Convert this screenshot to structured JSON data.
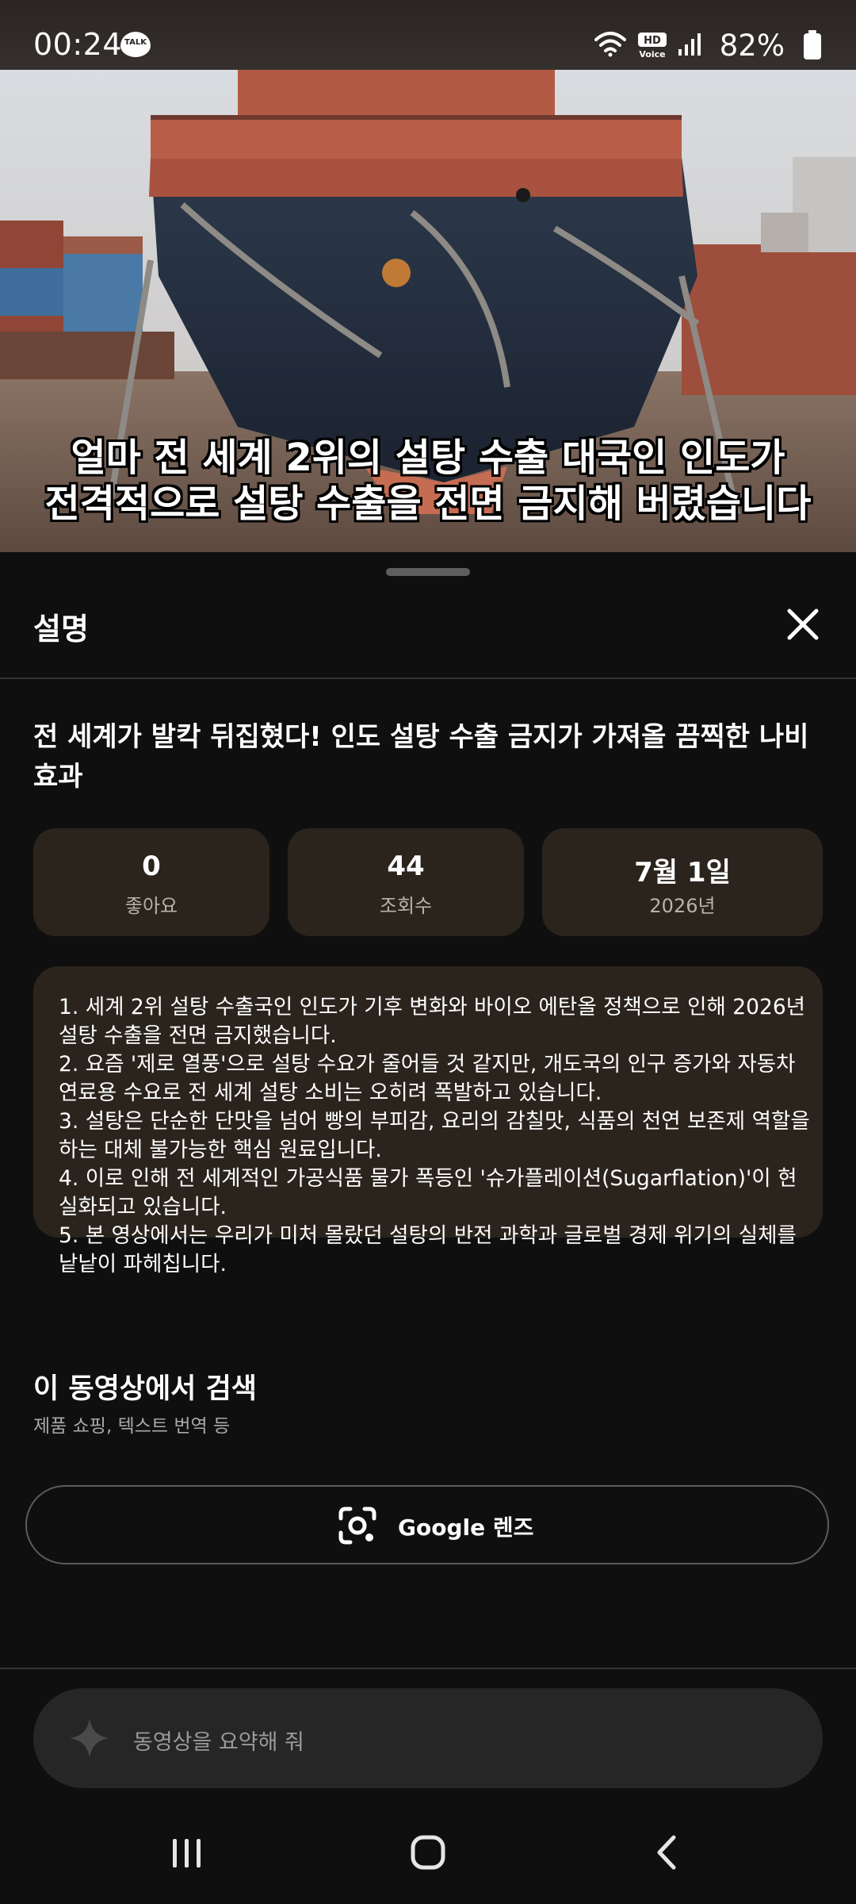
{
  "status_bar": {
    "time": "00:24",
    "talk_badge": "TALK",
    "hd_badge": "HD",
    "voice_badge": "Voice",
    "battery": "82%",
    "icons": [
      "kakaotalk-icon",
      "wifi-icon",
      "hd-voice-icon",
      "signal-icon",
      "battery-icon"
    ]
  },
  "video": {
    "subtitle_line1": "얼마 전 세계 2위의 설탕 수출 대국인 인도가",
    "subtitle_line2": "전격적으로 설탕 수출을 전면 금지해 버렸습니다"
  },
  "sheet": {
    "title": "설명",
    "close_icon": "close-icon"
  },
  "video_info": {
    "title": "전 세계가 발칵 뒤집혔다! 인도 설탕 수출 금지가 가져올 끔찍한 나비효과",
    "stats": [
      {
        "value": "0",
        "label": "좋아요"
      },
      {
        "value": "44",
        "label": "조회수"
      },
      {
        "value": "7월 1일",
        "label": "2026년"
      }
    ]
  },
  "description": {
    "lines": [
      "1. 세계 2위 설탕 수출국인 인도가 기후 변화와 바이오 에탄올 정책으로 인해 2026년 설탕 수출을 전면 금지했습니다.",
      "2. 요즘 '제로 열풍'으로 설탕 수요가 줄어들 것 같지만, 개도국의 인구 증가와 자동차 연료용 수요로 전 세계 설탕 소비는 오히려 폭발하고 있습니다.",
      "3. 설탕은 단순한 단맛을 넘어 빵의 부피감, 요리의 감칠맛, 식품의 천연 보존제 역할을 하는 대체 불가능한 핵심 원료입니다.",
      "4. 이로 인해 전 세계적인 가공식품 물가 폭등인 '슈가플레이션(Sugarflation)'이 현실화되고 있습니다.",
      "5. 본 영상에서는 우리가 미처 몰랐던 설탕의 반전 과학과 글로벌 경제 위기의 실체를 낱낱이 파헤칩니다."
    ]
  },
  "search_in_video": {
    "title": "이 동영상에서 검색",
    "subtitle": "제품 쇼핑, 텍스트 번역 등",
    "lens_button": "Google 렌즈",
    "lens_icon": "google-lens-icon"
  },
  "ask_bar": {
    "placeholder": "동영상을 요약해 줘",
    "icon": "sparkle-icon"
  },
  "nav": {
    "icons": [
      "recent-apps-icon",
      "home-icon",
      "back-icon"
    ]
  },
  "colors": {
    "background": "#0f0f0f",
    "card": "#2a241c",
    "divider": "#333333",
    "ask_bar": "#262626"
  }
}
